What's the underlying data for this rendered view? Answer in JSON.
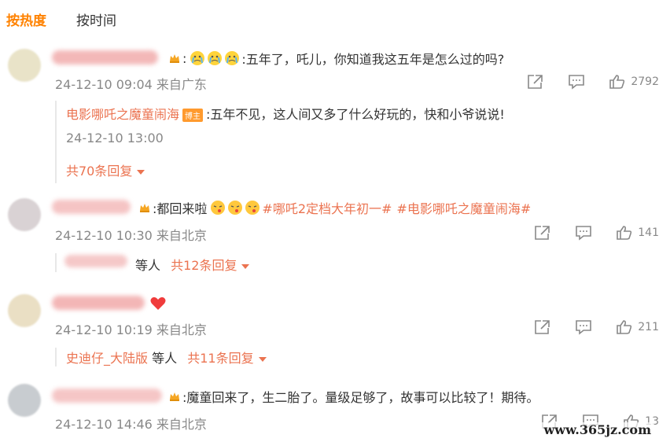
{
  "tabs": {
    "hot": "按热度",
    "time": "按时间"
  },
  "comments": [
    {
      "text": ":五年了，吒儿，你知道我这五年是怎么过的吗?",
      "time": "24-12-10 09:04",
      "location": "来自广东",
      "likes": "2792",
      "reply": {
        "author": "电影哪吒之魔童闹海",
        "badge": "博主",
        "text": ":五年不见，这人间又多了什么好玩的，快和小爷说说!",
        "time": "24-12-10 13:00",
        "more": "共70条回复"
      }
    },
    {
      "text_prefix": ":都回来啦",
      "tag1": "#哪吒2定档大年初一#",
      "tag2": "#电影哪吒之魔童闹海#",
      "time": "24-12-10 10:30",
      "location": "来自北京",
      "likes": "141",
      "reply_others": "等人",
      "more": "共12条回复"
    },
    {
      "time": "24-12-10 10:19",
      "location": "来自北京",
      "likes": "211",
      "reply_name": "史迪仔_大陆版",
      "reply_others": "等人",
      "more": "共11条回复"
    },
    {
      "text": ":魔童回来了，生二胎了。量级足够了，故事可以比较了！期待。",
      "time": "24-12-10 14:46",
      "location": "来自北京",
      "likes": "13"
    }
  ],
  "watermark": "www.365jz.com",
  "colors": {
    "accent": "#ff8200",
    "link": "#eb7350",
    "meta": "#888888"
  }
}
